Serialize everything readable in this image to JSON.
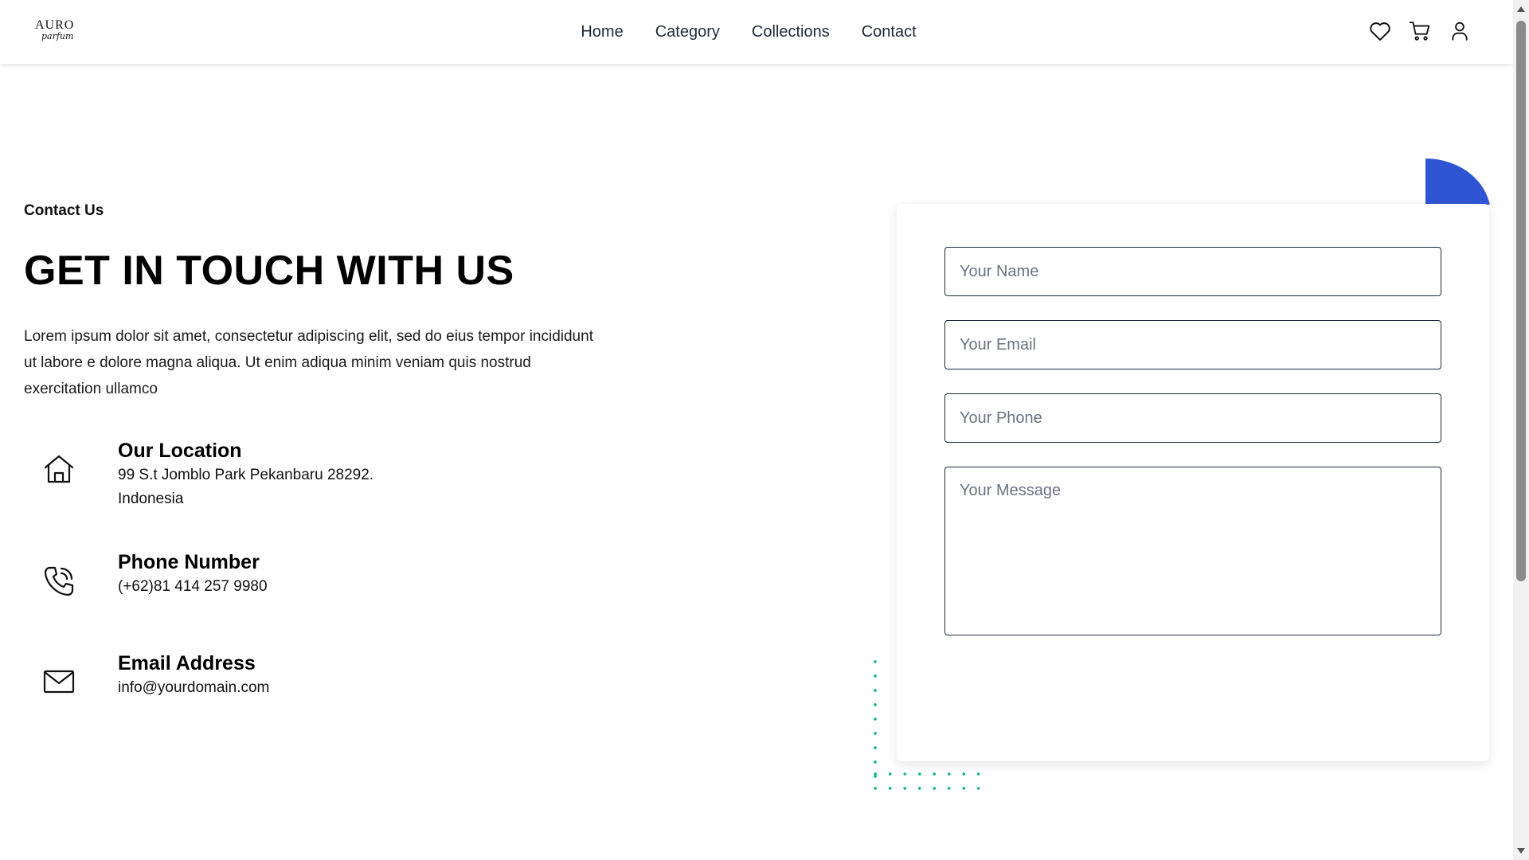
{
  "header": {
    "logo_top": "AURO",
    "logo_bottom": "parfum",
    "nav": [
      {
        "label": "Home"
      },
      {
        "label": "Category"
      },
      {
        "label": "Collections"
      },
      {
        "label": "Contact"
      }
    ],
    "icons": [
      "heart-icon",
      "cart-icon",
      "user-icon"
    ]
  },
  "contact": {
    "eyebrow": "Contact Us",
    "headline": "GET IN TOUCH WITH US",
    "intro": "Lorem ipsum dolor sit amet, consectetur adipiscing elit, sed do eius tempor incididunt ut labore e dolore magna aliqua. Ut enim adiqua minim veniam quis nostrud exercitation ullamco",
    "location": {
      "title": "Our Location",
      "line1": "99 S.t Jomblo Park Pekanbaru 28292.",
      "line2": "Indonesia",
      "icon": "home-icon"
    },
    "phone": {
      "title": "Phone Number",
      "line1": "(+62)81 414 257 9980",
      "icon": "phone-icon"
    },
    "email": {
      "title": "Email Address",
      "line1": "info@yourdomain.com",
      "icon": "mail-icon"
    }
  },
  "form": {
    "name_placeholder": "Your Name",
    "email_placeholder": "Your Email",
    "phone_placeholder": "Your Phone",
    "message_placeholder": "Your Message"
  },
  "colors": {
    "accent_blue": "#2f55d4",
    "dots_green": "#10b981",
    "text_dark": "#111111"
  }
}
